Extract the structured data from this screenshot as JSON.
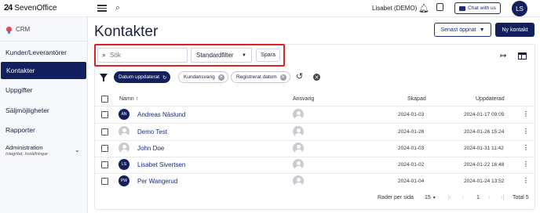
{
  "app": {
    "logo_mark": "24",
    "logo_text": "SevenOffice"
  },
  "topbar": {
    "user": "Lisabet (DEMO)",
    "chat_label": "Chat with us",
    "avatar": "LS"
  },
  "sidebar": {
    "module": "CRM",
    "items": [
      {
        "label": "Kunder/Leverantörer"
      },
      {
        "label": "Kontakter"
      },
      {
        "label": "Uppgifter"
      },
      {
        "label": "Säljmöjligheter"
      },
      {
        "label": "Rapporter"
      }
    ],
    "admin_label": "Administration",
    "admin_sub": "Integritet, Inställningar"
  },
  "page": {
    "title": "Kontakter",
    "recent_label": "Senast öppnat",
    "new_label": "Ny kontakt"
  },
  "toolbar": {
    "search_placeholder": "Sök",
    "filter_select": "Standardfilter",
    "save_label": "Spara"
  },
  "chips": [
    {
      "label": "Datum uppdaterat"
    },
    {
      "label": "Kundansvarig"
    },
    {
      "label": "Registrerat datum"
    }
  ],
  "table": {
    "headers": {
      "name": "Namn",
      "responsible": "Ansvarig",
      "created": "Skapad",
      "updated": "Uppdaterad"
    },
    "rows": [
      {
        "initials": "AN",
        "name": "Andreas Näslund",
        "created": "2024-01-03",
        "updated": "2024-01-17 09:05"
      },
      {
        "initials": "",
        "name": "Demo Test",
        "created": "2024-01-26",
        "updated": "2024-01-26 15:24"
      },
      {
        "initials": "",
        "name": "John Doe",
        "created": "2024-01-03",
        "updated": "2024-01-31 11:42"
      },
      {
        "initials": "LS",
        "name": "Lisabet Sivertsen",
        "created": "2024-01-02",
        "updated": "2024-01-22 16:48"
      },
      {
        "initials": "PW",
        "name": "Per Wangerud",
        "created": "2024-01-04",
        "updated": "2024-01-24 13:52"
      }
    ]
  },
  "footer": {
    "rows_per_page_label": "Rader per sida",
    "rows_per_page": "15",
    "page": "1",
    "total": "Total 5"
  }
}
